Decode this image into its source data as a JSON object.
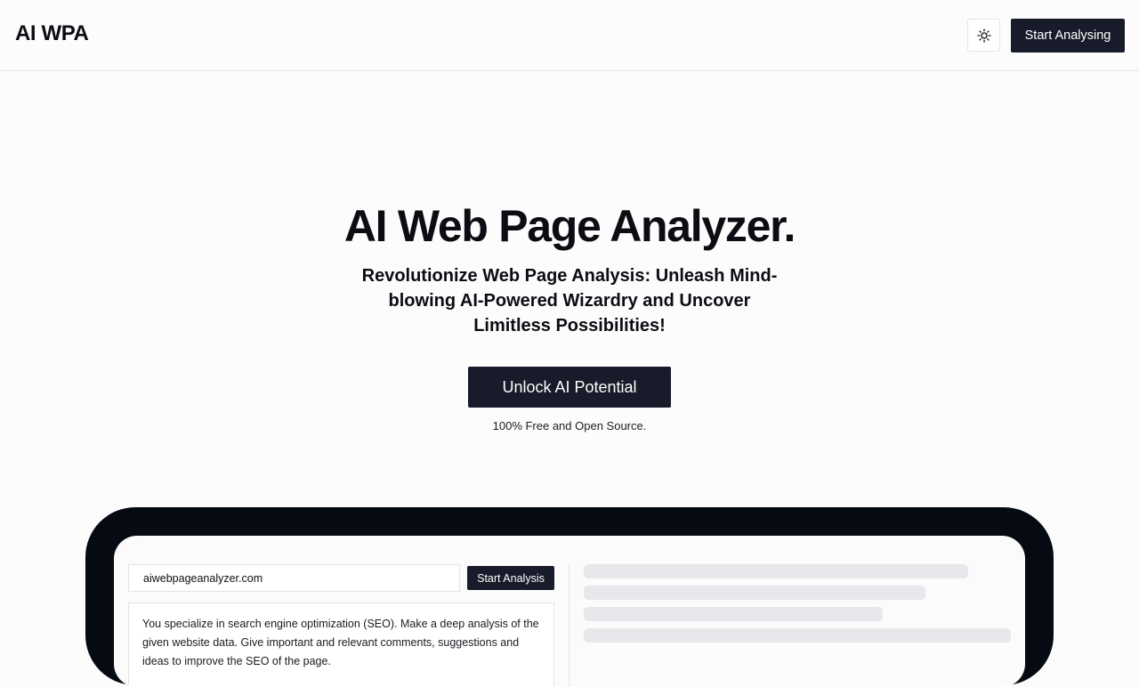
{
  "header": {
    "logo": "AI WPA",
    "theme_toggle_icon": "sun-icon",
    "start_label": "Start Analysing"
  },
  "hero": {
    "title": "AI Web Page Analyzer.",
    "subtitle": "Revolutionize Web Page Analysis: Unleash Mind-blowing AI-Powered Wizardry and Uncover Limitless Possibilities!",
    "cta_label": "Unlock AI Potential",
    "note": "100% Free and Open Source."
  },
  "demo": {
    "url_value": "aiwebpageanalyzer.com",
    "analysis_button": "Start Analysis",
    "prompt_text": "You specialize in search engine optimization (SEO). Make a deep analysis of the given website data. Give important and relevant comments, suggestions and ideas to improve the SEO of the page."
  },
  "colors": {
    "primary": "#181b29",
    "frame": "#060a12",
    "background": "#fcfcfc",
    "skeleton": "#e7e8ec"
  }
}
